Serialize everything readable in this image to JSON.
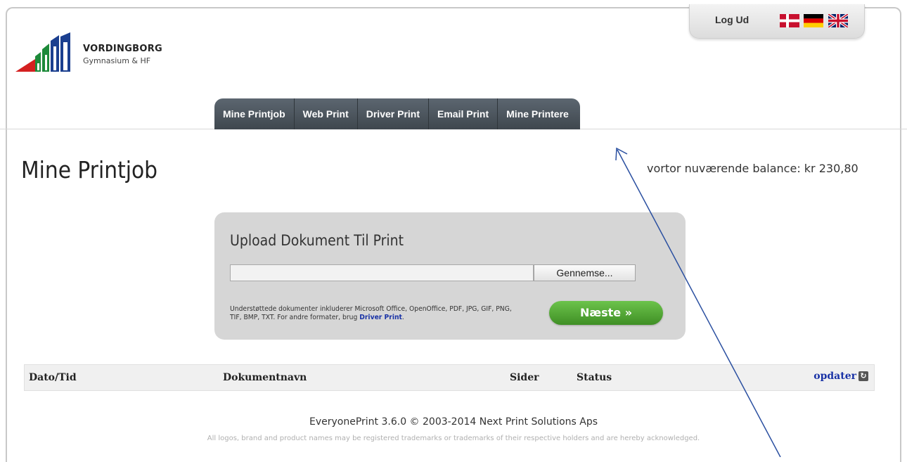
{
  "brand": {
    "name": "VORDINGBORG",
    "subtitle": "Gymnasium & HF",
    "colors": [
      "#d42020",
      "#1d8a3a",
      "#1b3f8f"
    ]
  },
  "header": {
    "logout_label": "Log Ud",
    "languages": [
      {
        "icon": "danish-flag-icon",
        "color": "#c8102e"
      },
      {
        "icon": "german-flag-icon",
        "color": "#000000"
      },
      {
        "icon": "uk-flag-icon",
        "color": "#012169"
      }
    ]
  },
  "nav": {
    "tabs": [
      {
        "label": "Mine Printjob"
      },
      {
        "label": "Web Print"
      },
      {
        "label": "Driver Print"
      },
      {
        "label": "Email Print"
      },
      {
        "label": "Mine Printere"
      }
    ]
  },
  "main": {
    "title": "Mine Printjob",
    "balance": "vortor nuværende balance: kr 230,80"
  },
  "upload": {
    "title": "Upload Dokument Til Print",
    "file_value": "",
    "browse_label": "Gennemse...",
    "support_text": "Understøttede dokumenter inkluderer Microsoft Office, OpenOffice, PDF, JPG, GIF, PNG, TIF, BMP, TXT. For andre formater, brug",
    "support_link": "Driver Print",
    "support_end": ".",
    "next_label": "Næste »",
    "accent_color": "#4aa52e"
  },
  "table": {
    "columns": [
      "Dato/Tid",
      "Dokumentnavn",
      "Sider",
      "Status"
    ],
    "refresh_label": "opdater",
    "rows": []
  },
  "footer": {
    "line1": "EveryonePrint 3.6.0 © 2003-2014 Next Print Solutions Aps",
    "line2": "All logos, brand and product names may be registered trademarks or trademarks of their respective holders and are hereby acknowledged."
  }
}
